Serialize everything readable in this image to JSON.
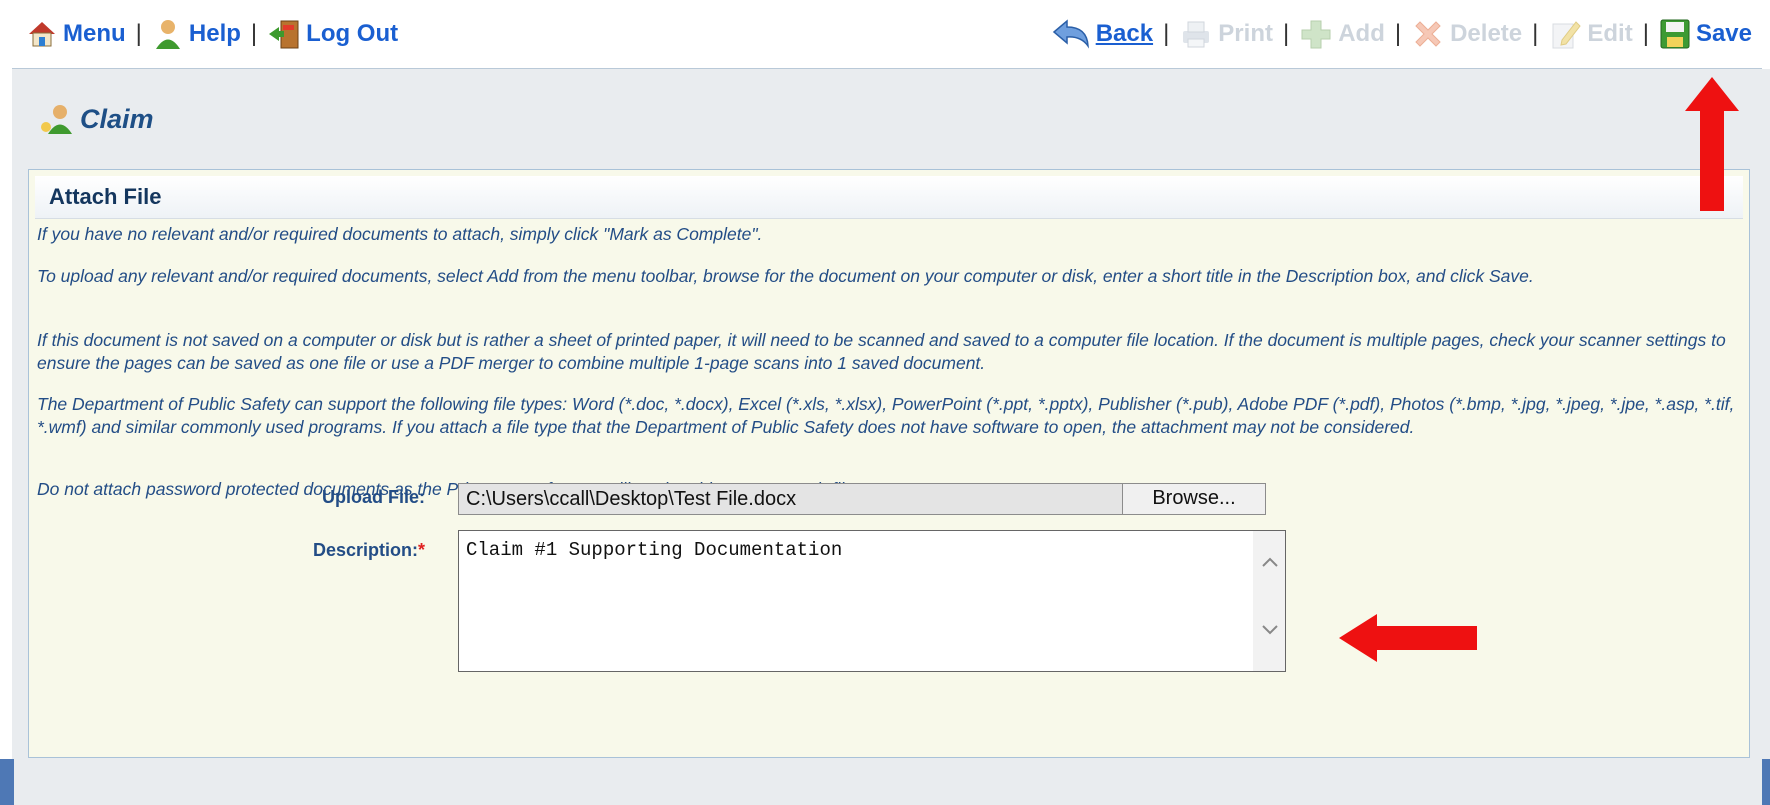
{
  "toolbar": {
    "menu": "Menu",
    "help": "Help",
    "logout": "Log Out",
    "back": "Back",
    "print": "Print",
    "add": "Add",
    "delete": "Delete",
    "edit": "Edit",
    "save": "Save",
    "separator": "|"
  },
  "page": {
    "title": "Claim"
  },
  "panel": {
    "title": "Attach File",
    "instructions": [
      "If you have no relevant and/or required documents to attach, simply click \"Mark as Complete\".",
      "To upload any relevant and/or required documents, select Add from the menu toolbar, browse for the document on your computer or disk, enter a short title in the Description box, and click Save.",
      "If this document is not saved on a computer or disk but is rather a sheet of printed paper, it will need to be scanned and saved to a computer file location. If the document is multiple pages, check your scanner settings to ensure the pages can be saved as one file or use a PDF merger to combine multiple 1-page scans into 1 saved document.",
      "The Department of Public Safety can support the following file types: Word (*.doc, *.docx), Excel (*.xls, *.xlsx), PowerPoint (*.ppt, *.pptx), Publisher (*.pub), Adobe PDF (*.pdf), Photos (*.bmp, *.jpg, *.jpeg, *.jpe, *.asp, *.tif, *.wmf) and similar commonly used programs. If you attach a file type that the Department of Public Safety does not have software to open, the attachment may not be considered.",
      "Do not attach password protected documents as the Print to PDF feature will not be able to open such file types."
    ]
  },
  "form": {
    "upload_label": "Upload File:",
    "upload_value": "C:\\Users\\ccall\\Desktop\\Test File.docx",
    "browse_label": "Browse...",
    "description_label": "Description:",
    "required_marker": "*",
    "description_value": "Claim #1 Supporting Documentation"
  },
  "colors": {
    "link": "#1a5fd1",
    "disabled": "#cdd4dc",
    "panel_bg": "#f8f9ea",
    "annotation_arrow": "#ee1111"
  },
  "icons": [
    "home-icon",
    "help-person-icon",
    "logout-door-icon",
    "back-arrow-icon",
    "printer-icon",
    "add-icon",
    "delete-icon",
    "edit-icon",
    "save-disk-icon",
    "claim-icon"
  ]
}
